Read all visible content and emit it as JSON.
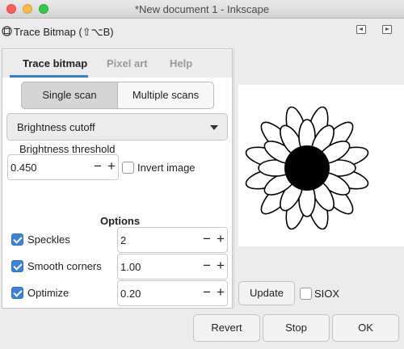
{
  "window": {
    "title": "*New document 1 - Inkscape"
  },
  "dialog": {
    "title": "Trace Bitmap (⇧⌥B)",
    "icon": "trace-bitmap-icon"
  },
  "tabs": [
    {
      "label": "Trace bitmap",
      "active": true
    },
    {
      "label": "Pixel art",
      "active": false
    },
    {
      "label": "Help",
      "active": false
    }
  ],
  "scan_modes": [
    {
      "label": "Single scan",
      "selected": true
    },
    {
      "label": "Multiple scans",
      "selected": false
    }
  ],
  "mode_dropdown": {
    "value": "Brightness cutoff"
  },
  "threshold": {
    "label": "Brightness threshold",
    "value": "0.450"
  },
  "invert": {
    "label": "Invert image",
    "checked": false
  },
  "options": {
    "heading": "Options",
    "speckles": {
      "label": "Speckles",
      "checked": true,
      "value": "2"
    },
    "smooth_corners": {
      "label": "Smooth corners",
      "checked": true,
      "value": "1.00"
    },
    "optimize": {
      "label": "Optimize",
      "checked": true,
      "value": "0.20"
    }
  },
  "spin": {
    "minus": "−",
    "plus": "+"
  },
  "preview": {
    "update_label": "Update",
    "siox_label": "SIOX",
    "siox_checked": false
  },
  "footer": {
    "revert_label": "Revert",
    "stop_label": "Stop",
    "ok_label": "OK"
  },
  "colors": {
    "accent": "#3a7bd5",
    "checkbox": "#3b82e0"
  }
}
